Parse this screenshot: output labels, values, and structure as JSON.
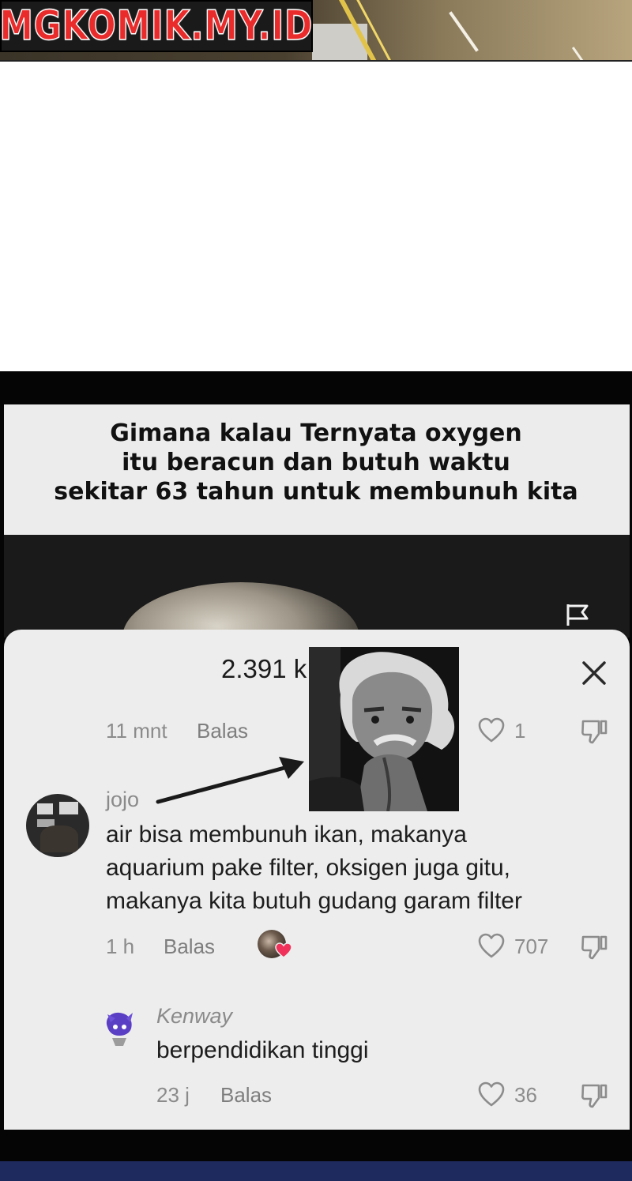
{
  "watermark": {
    "text": "MGKOMIK.MY.ID"
  },
  "meme": {
    "title": "Gimana kalau Ternyata oxygen\nitu beracun dan butuh waktu\nsekitar 63 tahun untuk membunuh kita"
  },
  "sheet": {
    "count_label": "2.391 k",
    "comments": [
      {
        "time": "11 mnt",
        "reply_label": "Balas",
        "likes": "1"
      },
      {
        "username": "jojo",
        "text": "air bisa membunuh ikan, makanya\naquarium pake filter, oksigen juga gitu,\nmakanya kita butuh gudang garam filter",
        "time": "1 h",
        "reply_label": "Balas",
        "likes": "707"
      },
      {
        "username": "Kenway",
        "text": "berpendidikan tinggi",
        "time": "23 j",
        "reply_label": "Balas",
        "likes": "36"
      }
    ]
  },
  "icons": {
    "flag": "flag-icon",
    "close": "close-icon",
    "heart": "heart-icon",
    "dislike": "thumbs-down-icon"
  },
  "colors": {
    "sheet_bg": "#ededed",
    "watermark_red": "#e92b2b",
    "bottom_bar": "#1e2a5e"
  }
}
